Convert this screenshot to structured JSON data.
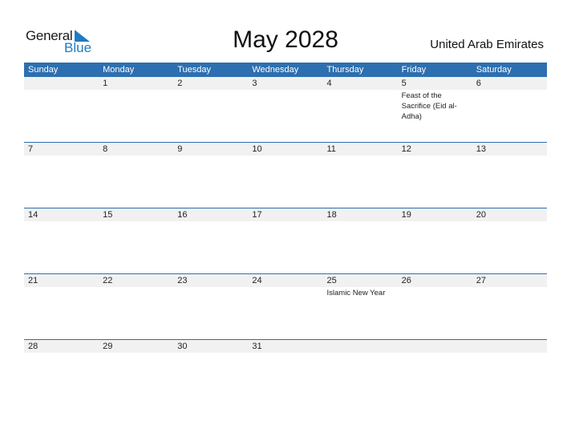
{
  "logo": {
    "general": "General",
    "blue": "Blue"
  },
  "title": "May 2028",
  "country": "United Arab Emirates",
  "colors": {
    "header_bg": "#2d6fb0",
    "date_band": "#f1f1f1",
    "logo_blue": "#1e7bc4"
  },
  "weekdays": [
    "Sunday",
    "Monday",
    "Tuesday",
    "Wednesday",
    "Thursday",
    "Friday",
    "Saturday"
  ],
  "weeks": [
    {
      "days": [
        "",
        "1",
        "2",
        "3",
        "4",
        "5",
        "6"
      ],
      "events": [
        "",
        "",
        "",
        "",
        "",
        "Feast of the Sacrifice (Eid al-Adha)",
        ""
      ]
    },
    {
      "days": [
        "7",
        "8",
        "9",
        "10",
        "11",
        "12",
        "13"
      ],
      "events": [
        "",
        "",
        "",
        "",
        "",
        "",
        ""
      ]
    },
    {
      "days": [
        "14",
        "15",
        "16",
        "17",
        "18",
        "19",
        "20"
      ],
      "events": [
        "",
        "",
        "",
        "",
        "",
        "",
        ""
      ]
    },
    {
      "days": [
        "21",
        "22",
        "23",
        "24",
        "25",
        "26",
        "27"
      ],
      "events": [
        "",
        "",
        "",
        "",
        "Islamic New Year",
        "",
        ""
      ]
    },
    {
      "days": [
        "28",
        "29",
        "30",
        "31",
        "",
        "",
        ""
      ],
      "events": [
        "",
        "",
        "",
        "",
        "",
        "",
        ""
      ]
    }
  ]
}
